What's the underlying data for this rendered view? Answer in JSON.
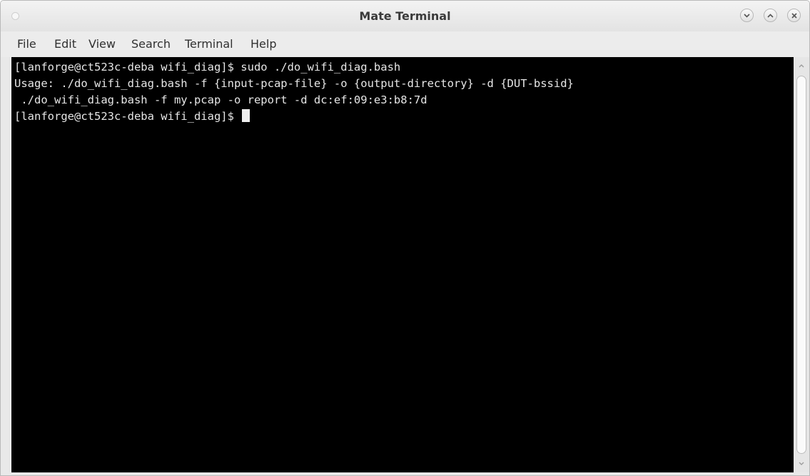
{
  "window": {
    "title": "Mate Terminal"
  },
  "menu": [
    {
      "label": "File"
    },
    {
      "label": "Edit"
    },
    {
      "label": "View"
    },
    {
      "label": "Search"
    },
    {
      "label": "Terminal"
    },
    {
      "label": "Help"
    }
  ],
  "terminal": {
    "lines": [
      "[lanforge@ct523c-deba wifi_diag]$ sudo ./do_wifi_diag.bash",
      "Usage: ./do_wifi_diag.bash -f {input-pcap-file} -o {output-directory} -d {DUT-bssid}",
      " ./do_wifi_diag.bash -f my.pcap -o report -d dc:ef:09:e3:b8:7d",
      "[lanforge@ct523c-deba wifi_diag]$ "
    ]
  },
  "icons": {
    "window_menu": "window-menu-dot-icon",
    "minimize": "minimize-chevron-down-icon",
    "maximize": "maximize-chevron-up-icon",
    "close": "close-x-icon",
    "scroll_up": "arrow-up-icon",
    "scroll_down": "arrow-down-icon"
  },
  "colors": {
    "terminal_background": "#000000",
    "terminal_text": "#e6e6e6",
    "chrome_background": "#e9e9e9"
  }
}
